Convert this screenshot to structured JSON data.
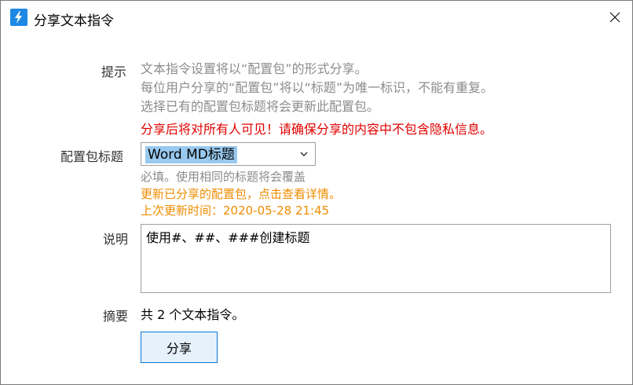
{
  "window": {
    "title": "分享文本指令"
  },
  "labels": {
    "hint": "提示",
    "package_title": "配置包标题",
    "description": "说明",
    "summary": "摘要"
  },
  "hints": [
    "文本指令设置将以“配置包”的形式分享。",
    "每位用户分享的“配置包”将以“标题”为唯一标识，不能有重复。",
    "选择已有的配置包标题将会更新此配置包。"
  ],
  "warning": "分享后将对所有人可见！请确保分享的内容中不包含隐私信息。",
  "package_select": {
    "value": "Word MD标题"
  },
  "package_notes": {
    "required": "必填。使用相同的标题将会覆盖",
    "update_link": "更新已分享的配置包，点击查看详情。",
    "last_updated": "上次更新时间：2020-05-28 21:45"
  },
  "description_value": "使用#、##、###创建标题",
  "summary_text": "共 2 个文本指令。",
  "share_button": "分享",
  "colors": {
    "accent": "#0a78d7",
    "warning": "#e00000",
    "info": "#ef8c00",
    "hint": "#8c8c8c"
  }
}
